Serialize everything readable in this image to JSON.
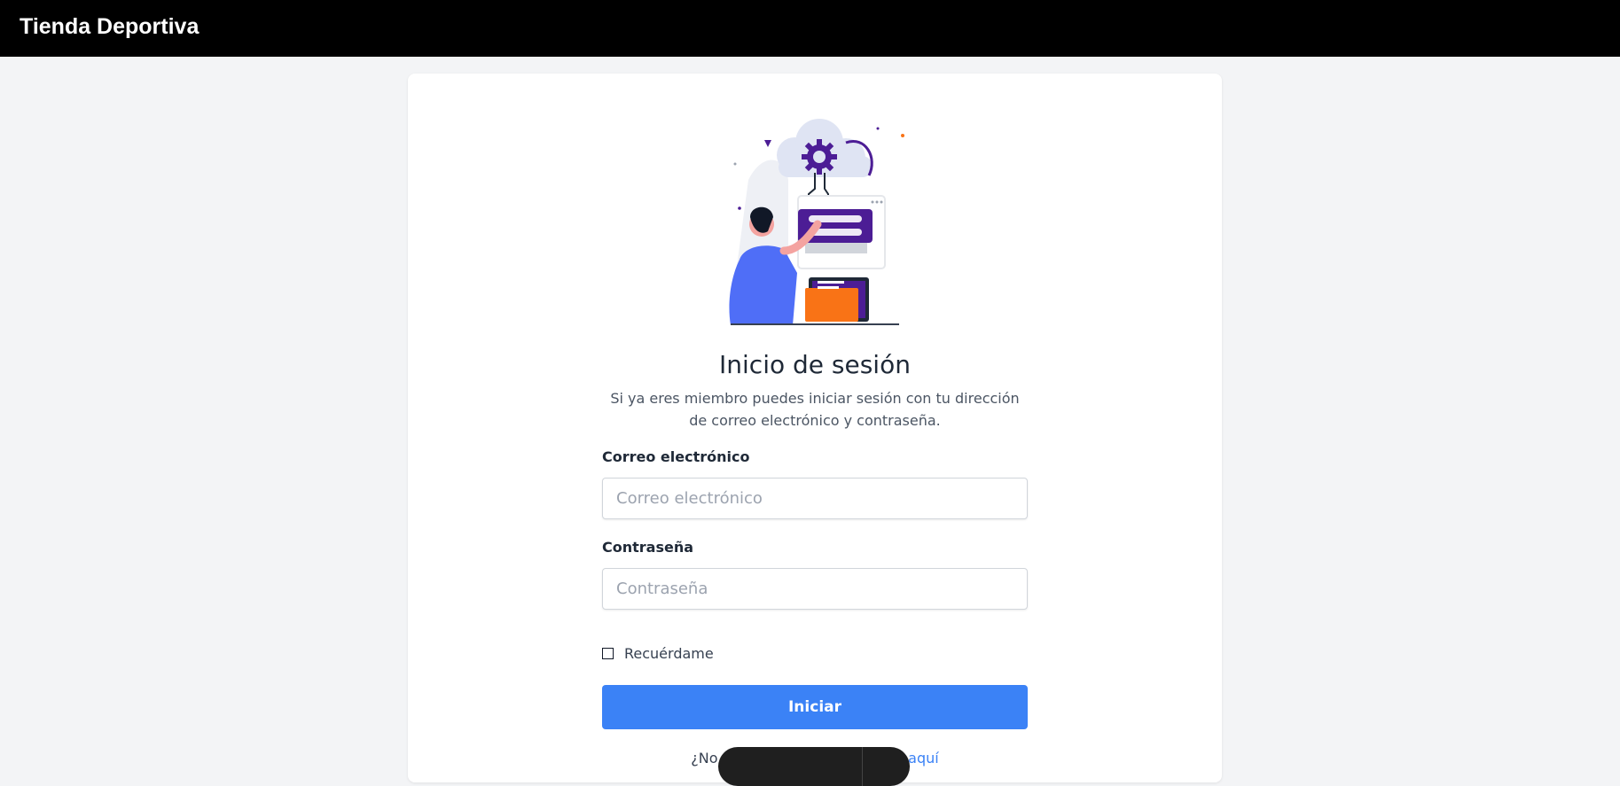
{
  "navbar": {
    "brand": "Tienda Deportiva"
  },
  "login": {
    "title": "Inicio de sesión",
    "subtitle": "Si ya eres miembro puedes iniciar sesión con tu dirección de correo electrónico y contraseña.",
    "email_label": "Correo electrónico",
    "email_placeholder": "Correo electrónico",
    "email_value": "",
    "password_label": "Contraseña",
    "password_placeholder": "Contraseña",
    "password_value": "",
    "remember_label": "Recuérdame",
    "remember_checked": false,
    "submit_label": "Iniciar",
    "register_prefix": "¿No tienes cuenta? ",
    "register_link": "Regístrate aquí"
  },
  "colors": {
    "navbar_bg": "#000000",
    "page_bg": "#f3f4f6",
    "primary": "#3b82f6",
    "illustration_purple": "#4c1d95",
    "illustration_blue": "#4f6ef7",
    "illustration_orange": "#f97316"
  },
  "icons": {
    "illustration": "login-illustration-person-cloud-gear"
  }
}
